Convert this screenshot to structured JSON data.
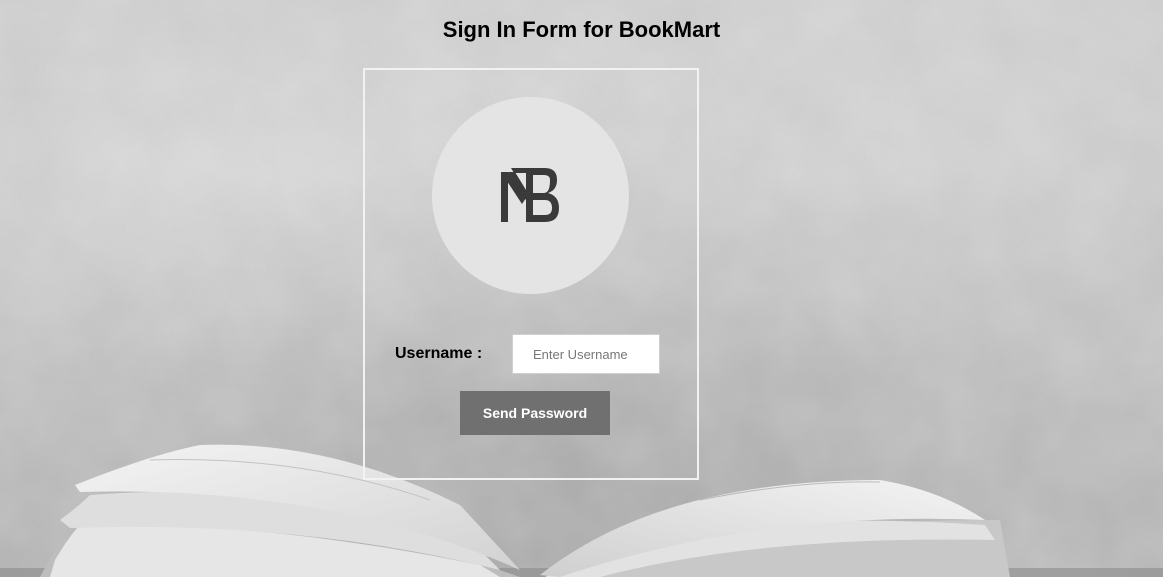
{
  "page": {
    "title": "Sign In Form for BookMart"
  },
  "form": {
    "logo_icon": "bookmart-bm-logo-icon",
    "username_label": "Username :",
    "username_placeholder": "Enter Username",
    "username_value": "",
    "submit_label": "Send Password"
  },
  "colors": {
    "button_bg": "#707070",
    "button_text": "#ffffff",
    "logo_circle": "#e4e4e4",
    "logo_mark": "#3a3a3a",
    "form_border": "#f2f2f2"
  }
}
